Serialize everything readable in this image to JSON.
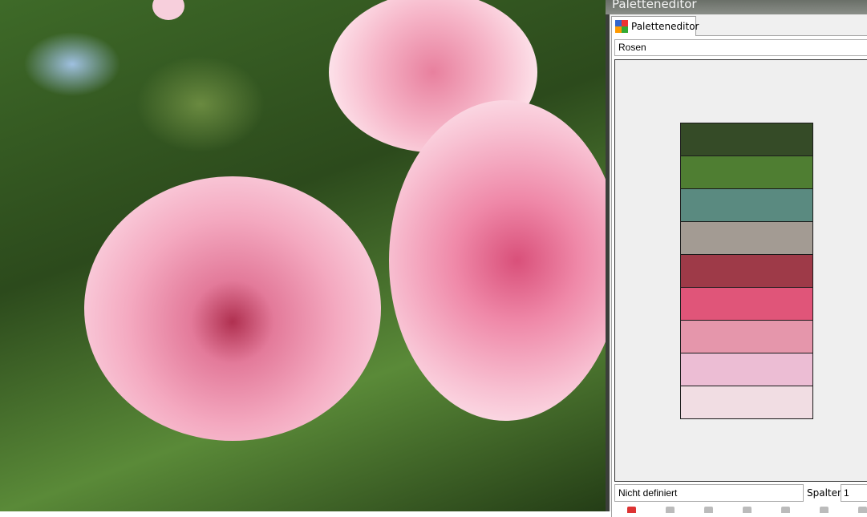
{
  "window": {
    "title": "Paletteneditor"
  },
  "tab": {
    "label": "Paletteneditor",
    "icon": "palette-icon"
  },
  "palette": {
    "name": "Rosen",
    "swatches": [
      "#354b27",
      "#4f7e32",
      "#5a8a80",
      "#a39b93",
      "#9e3a48",
      "#e05579",
      "#e596ab",
      "#ecbdd4",
      "#f1dde3"
    ]
  },
  "status": {
    "color_name": "Nicht definiert",
    "columns_label": "Spalten:",
    "columns_value": "1"
  },
  "toolbar": {
    "icons": [
      "new-color-icon",
      "edit-color-icon",
      "delete-color-icon",
      "color-from-fg-icon",
      "zoom-out-icon",
      "zoom-in-icon",
      "zoom-all-icon"
    ]
  }
}
